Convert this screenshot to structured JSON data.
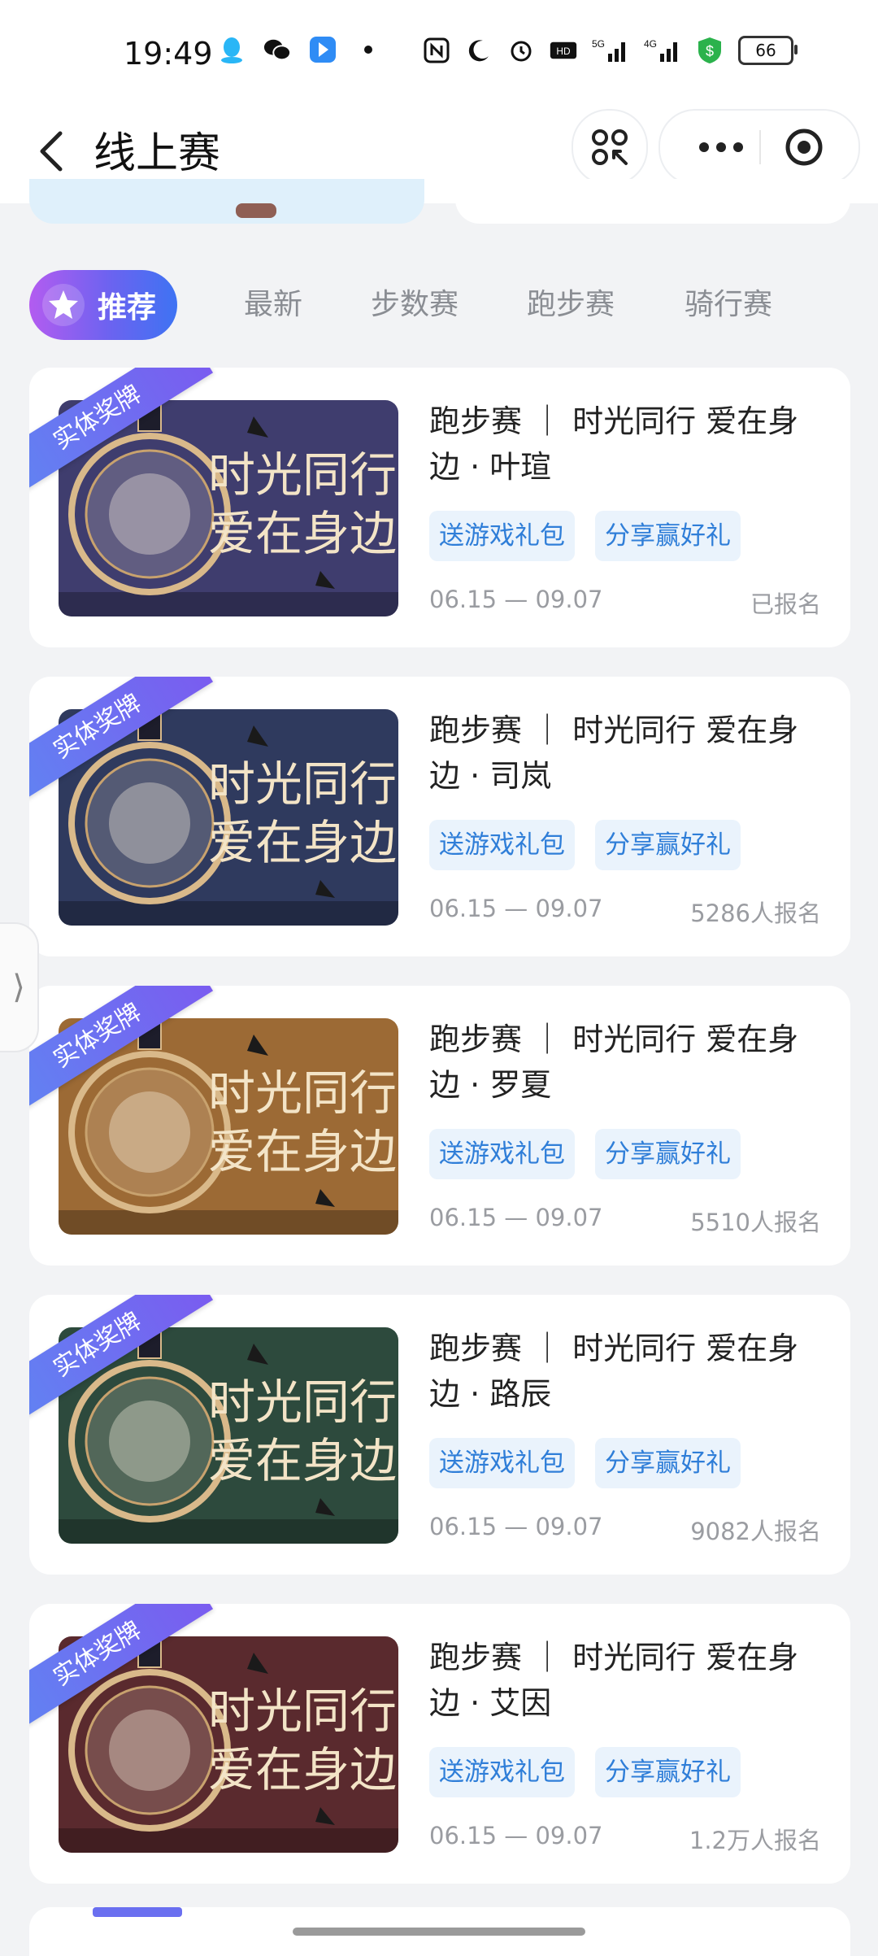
{
  "status_bar": {
    "time": "19:49",
    "left_icons": [
      "qq-icon",
      "wechat-icon",
      "app-icon",
      "dot-icon"
    ],
    "right_icons": [
      "nfc-icon",
      "moon-icon",
      "alarm-icon",
      "hd-icon",
      "5g-signal-icon",
      "4g-signal-icon",
      "shield-icon"
    ],
    "battery": "66"
  },
  "nav": {
    "title": "线上赛"
  },
  "tabs": [
    {
      "label": "推荐",
      "active": true
    },
    {
      "label": "最新",
      "active": false
    },
    {
      "label": "步数赛",
      "active": false
    },
    {
      "label": "跑步赛",
      "active": false
    },
    {
      "label": "骑行赛",
      "active": false
    }
  ],
  "cards": [
    {
      "ribbon": "实体奖牌",
      "title": "跑步赛 ｜ 时光同行 爱在身边 · 叶瑄",
      "tags": [
        "送游戏礼包",
        "分享赢好礼"
      ],
      "date": "06.15 — 09.07",
      "status": "已报名",
      "thumb_color": "#3f3d6e"
    },
    {
      "ribbon": "实体奖牌",
      "title": "跑步赛 ｜ 时光同行 爱在身边 · 司岚",
      "tags": [
        "送游戏礼包",
        "分享赢好礼"
      ],
      "date": "06.15 — 09.07",
      "status": "5286人报名",
      "thumb_color": "#2f3a5e"
    },
    {
      "ribbon": "实体奖牌",
      "title": "跑步赛 ｜ 时光同行 爱在身边 · 罗夏",
      "tags": [
        "送游戏礼包",
        "分享赢好礼"
      ],
      "date": "06.15 — 09.07",
      "status": "5510人报名",
      "thumb_color": "#9c6a35"
    },
    {
      "ribbon": "实体奖牌",
      "title": "跑步赛 ｜ 时光同行 爱在身边 · 路辰",
      "tags": [
        "送游戏礼包",
        "分享赢好礼"
      ],
      "date": "06.15 — 09.07",
      "status": "9082人报名",
      "thumb_color": "#2d4a3d"
    },
    {
      "ribbon": "实体奖牌",
      "title": "跑步赛 ｜ 时光同行 爱在身边 · 艾因",
      "tags": [
        "送游戏礼包",
        "分享赢好礼"
      ],
      "date": "06.15 — 09.07",
      "status": "1.2万人报名",
      "thumb_color": "#5a2a2e"
    }
  ],
  "thumb_text": {
    "line1": "时光同行",
    "line2": "爱在身边"
  },
  "side_handle": "⟩"
}
